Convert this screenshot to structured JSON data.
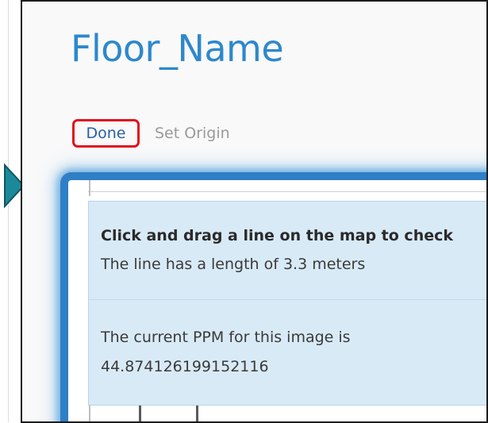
{
  "page": {
    "floor_title": "Floor_Name"
  },
  "actions": {
    "done_label": "Done",
    "set_origin_label": "Set Origin"
  },
  "info": {
    "instruction": "Click and drag a line on the map to check",
    "length_text": "The line has a length of 3.3 meters",
    "ppm_label": "The current PPM for this image is",
    "ppm_value": "44.874126199152116"
  },
  "colors": {
    "title": "#2d88cc",
    "highlight_border": "#e0121d",
    "panel_glow": "#2e7fc6",
    "info_background": "#d9eaf7",
    "arrow": "#1a8a9a"
  },
  "icons": {
    "arrow": "arrow-right-icon"
  }
}
